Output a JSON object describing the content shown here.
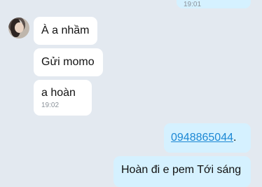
{
  "top_bubble": {
    "time": "19:01"
  },
  "incoming": {
    "messages": [
      {
        "text": "À a nhầm"
      },
      {
        "text": "Gửi momo"
      },
      {
        "text": "a hoàn",
        "time": "19:02"
      }
    ]
  },
  "outgoing": {
    "phone_link": "0948865044",
    "phone_suffix": ".",
    "last_text": "Hoàn đi e pem Tới sáng"
  }
}
